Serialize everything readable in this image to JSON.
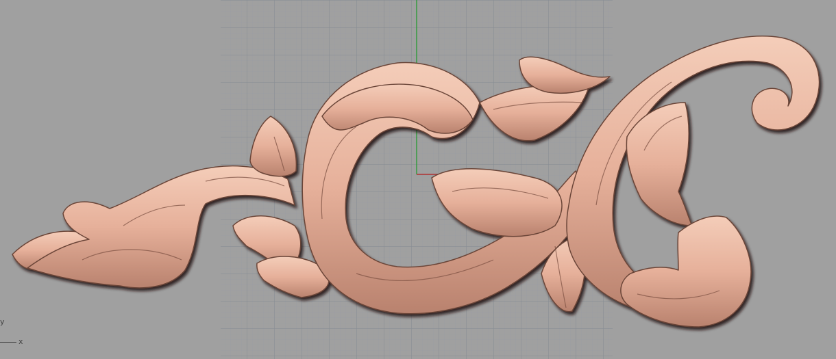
{
  "app": {
    "view": "Top",
    "background_color": "#a0a0a0",
    "grid_color": "#8d9299",
    "model_color": "#e6b5a0"
  },
  "axes": {
    "x_label": "x",
    "y_label": "y"
  },
  "model": {
    "description_icon": "baroque-acanthus-scroll-relief"
  }
}
